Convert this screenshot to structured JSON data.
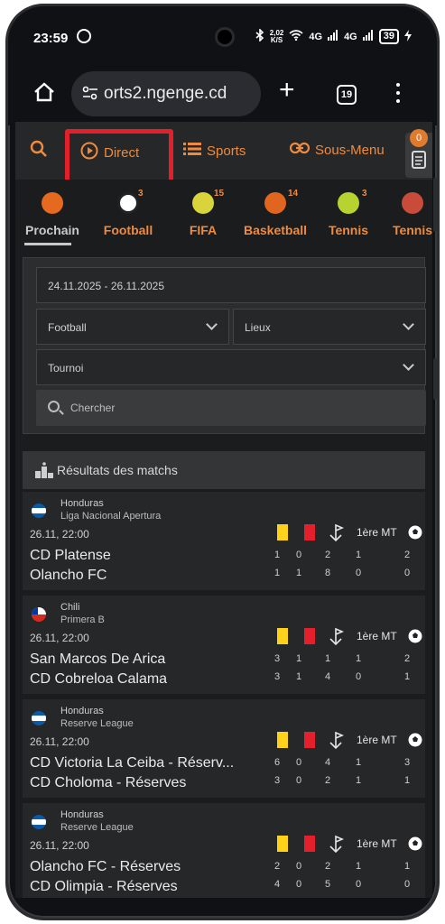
{
  "status_bar": {
    "time": "23:59",
    "speed": "2,02",
    "speed_unit": "K/S",
    "net1": "4G",
    "net2": "4G",
    "battery": "39"
  },
  "browser": {
    "url": "orts2.ngenge.cd",
    "tab_count": "19"
  },
  "nav": {
    "direct": "Direct",
    "sports": "Sports",
    "sous_menu": "Sous-Menu",
    "coupon_count": "0"
  },
  "sports": [
    {
      "label": "Prochain",
      "count": ""
    },
    {
      "label": "Football",
      "count": "3"
    },
    {
      "label": "FIFA",
      "count": "15"
    },
    {
      "label": "Basketball",
      "count": "14"
    },
    {
      "label": "Tennis",
      "count": "3"
    },
    {
      "label": "Tennis",
      "count": ""
    }
  ],
  "filters": {
    "date_range": "24.11.2025 - 26.11.2025",
    "sport": "Football",
    "lieux": "Lieux",
    "tournoi": "Tournoi",
    "search_placeholder": "Chercher"
  },
  "results_title": "Résultats des matchs",
  "period_label": "1ère MT",
  "matches": [
    {
      "country": "Honduras",
      "league": "Liga Nacional Apertura",
      "datetime": "26.11, 22:00",
      "home": "CD Platense",
      "away": "Olancho FC",
      "home_stats": [
        "1",
        "0",
        "2",
        "1",
        "2"
      ],
      "away_stats": [
        "1",
        "1",
        "8",
        "0",
        "0"
      ]
    },
    {
      "country": "Chili",
      "league": "Primera B",
      "datetime": "26.11, 22:00",
      "home": "San Marcos De Arica",
      "away": "CD Cobreloa Calama",
      "home_stats": [
        "3",
        "1",
        "1",
        "1",
        "2"
      ],
      "away_stats": [
        "3",
        "1",
        "4",
        "0",
        "1"
      ]
    },
    {
      "country": "Honduras",
      "league": "Reserve League",
      "datetime": "26.11, 22:00",
      "home": "CD Victoria La Ceiba - Réserv...",
      "away": "CD Choloma - Réserves",
      "home_stats": [
        "6",
        "0",
        "4",
        "1",
        "3"
      ],
      "away_stats": [
        "3",
        "0",
        "2",
        "1",
        "1"
      ]
    },
    {
      "country": "Honduras",
      "league": "Reserve League",
      "datetime": "26.11, 22:00",
      "home": "Olancho FC - Réserves",
      "away": "CD Olimpia - Réserves",
      "home_stats": [
        "2",
        "0",
        "2",
        "1",
        "1"
      ],
      "away_stats": [
        "4",
        "0",
        "5",
        "0",
        "0"
      ]
    }
  ],
  "colors": {
    "accent": "#f08a3c",
    "highlight_box": "#e2202b",
    "yellow_card": "#ffd21a",
    "red_card": "#e3202b"
  }
}
